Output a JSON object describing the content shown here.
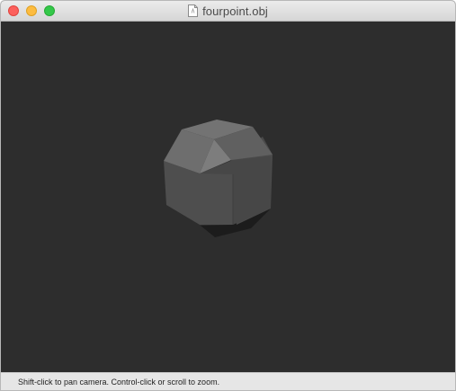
{
  "window": {
    "title": "fourpoint.obj",
    "title_icon": "document-icon"
  },
  "titlebar": {
    "buttons": [
      {
        "name": "close",
        "color": "#fc605c"
      },
      {
        "name": "minimize",
        "color": "#fdbc40"
      },
      {
        "name": "zoom",
        "color": "#34c84a"
      }
    ]
  },
  "viewport": {
    "background": "#2d2d2d",
    "model": "gray polyhedron"
  },
  "status": {
    "text": "Shift-click to pan camera. Control-click or scroll to zoom."
  }
}
